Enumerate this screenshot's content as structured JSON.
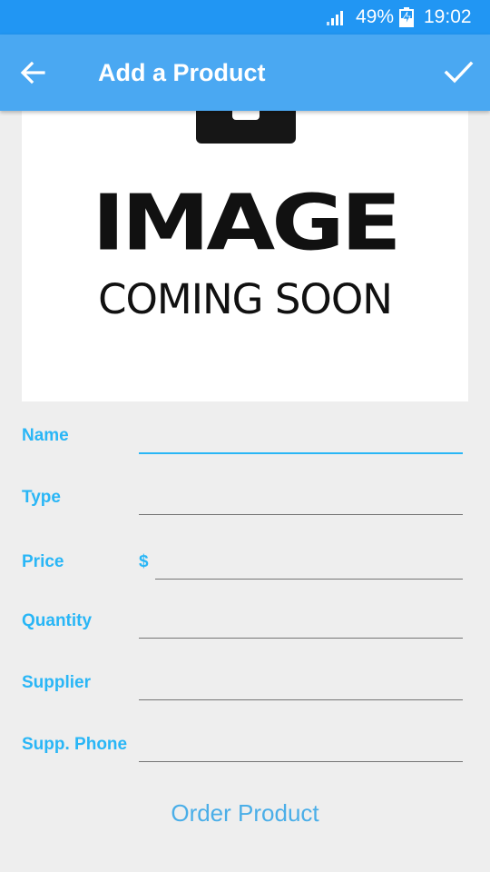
{
  "status_bar": {
    "battery_percent": "49%",
    "time": "19:02",
    "icons": [
      "signal-icon",
      "battery-charging-icon"
    ]
  },
  "app_bar": {
    "title": "Add a Product",
    "back_icon": "arrow-left-icon",
    "save_icon": "check-icon",
    "background_color": "#4aa8f2"
  },
  "product_image": {
    "line1": "IMAGE",
    "line2": "COMING SOON"
  },
  "form": {
    "accent_color": "#29b6f6",
    "fields": {
      "name": {
        "label": "Name",
        "value": ""
      },
      "type": {
        "label": "Type",
        "value": ""
      },
      "price": {
        "label": "Price",
        "currency_symbol": "$",
        "value": ""
      },
      "quantity": {
        "label": "Quantity",
        "value": ""
      },
      "supplier": {
        "label": "Supplier",
        "value": ""
      },
      "supplier_phone": {
        "label": "Supp. Phone",
        "value": ""
      }
    }
  },
  "order_button": {
    "label": "Order Product"
  }
}
